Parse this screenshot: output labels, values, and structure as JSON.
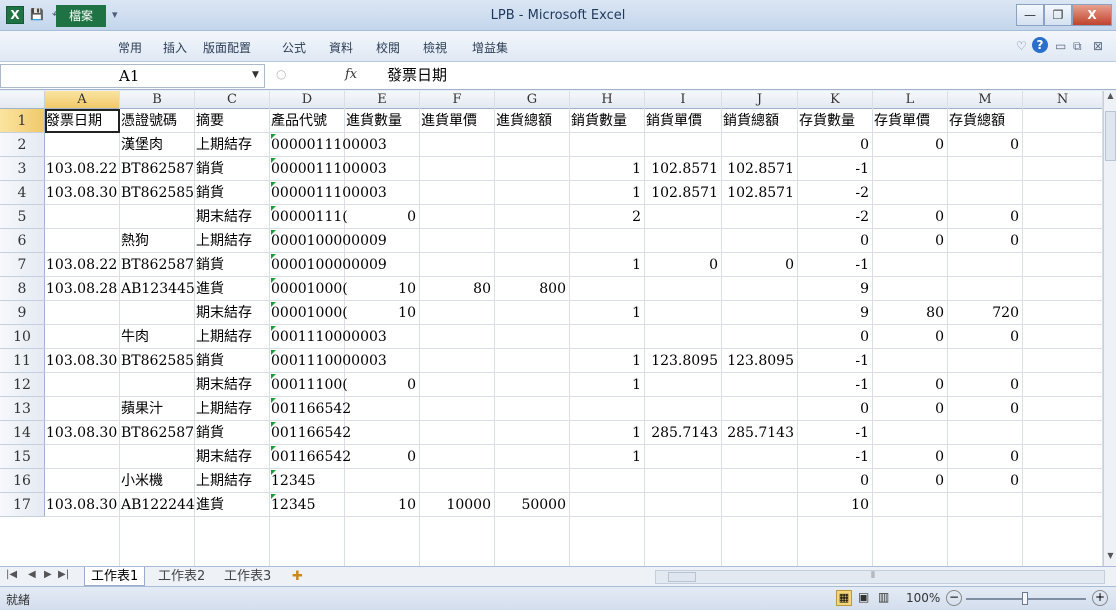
{
  "window": {
    "title": "LPB - Microsoft Excel",
    "app_icon": "X"
  },
  "quick_access": {
    "save": "💾",
    "undo": "↶ ▾",
    "redo": "↷ ▾",
    "customize": "▾"
  },
  "window_controls": {
    "minimize": "—",
    "restore": "❐",
    "close": "X"
  },
  "ribbon": {
    "tabs": [
      "檔案",
      "常用",
      "插入",
      "版面配置",
      "公式",
      "資料",
      "校閱",
      "檢視",
      "增益集"
    ],
    "right_icons": [
      "♡",
      "?",
      "▭",
      "⧉",
      "⊠"
    ],
    "help_color": "#2a6fc9"
  },
  "formula_bar": {
    "name_box": "A1",
    "fx_label": "fx",
    "cancel": "○",
    "value": "發票日期"
  },
  "columns": [
    "A",
    "B",
    "C",
    "D",
    "E",
    "F",
    "G",
    "H",
    "I",
    "J",
    "K",
    "L",
    "M",
    "N"
  ],
  "rows": [
    {
      "n": "1",
      "cells": {
        "A": "發票日期",
        "B": "憑證號碼",
        "C": "摘要",
        "D": "產品代號",
        "E": "進貨數量",
        "F": "進貨單價",
        "G": "進貨總額",
        "H": "銷貨數量",
        "I": "銷貨單價",
        "J": "銷貨總額",
        "K": "存貨數量",
        "L": "存貨單價",
        "M": "存貨總額"
      }
    },
    {
      "n": "2",
      "cells": {
        "B": "漢堡肉",
        "C": "上期結存",
        "D": "0000011100003",
        "K": "0",
        "L": "0",
        "M": "0"
      }
    },
    {
      "n": "3",
      "cells": {
        "A": "103.08.22",
        "B": "BT862587",
        "C": "銷貨",
        "D": "0000011100003",
        "H": "1",
        "I": "102.8571",
        "J": "102.8571",
        "K": "-1"
      }
    },
    {
      "n": "4",
      "cells": {
        "A": "103.08.30",
        "B": "BT862585",
        "C": "銷貨",
        "D": "0000011100003",
        "H": "1",
        "I": "102.8571",
        "J": "102.8571",
        "K": "-2"
      }
    },
    {
      "n": "5",
      "cells": {
        "C": "期末結存",
        "D": "00000111(",
        "E": "0",
        "H": "2",
        "K": "-2",
        "L": "0",
        "M": "0"
      }
    },
    {
      "n": "6",
      "cells": {
        "B": "熱狗",
        "C": "上期結存",
        "D": "0000100000009",
        "K": "0",
        "L": "0",
        "M": "0"
      }
    },
    {
      "n": "7",
      "cells": {
        "A": "103.08.22",
        "B": "BT862587",
        "C": "銷貨",
        "D": "0000100000009",
        "H": "1",
        "I": "0",
        "J": "0",
        "K": "-1"
      }
    },
    {
      "n": "8",
      "cells": {
        "A": "103.08.28",
        "B": "AB123445",
        "C": "進貨",
        "D": "00001000(",
        "E": "10",
        "F": "80",
        "G": "800",
        "K": "9"
      }
    },
    {
      "n": "9",
      "cells": {
        "C": "期末結存",
        "D": "00001000(",
        "E": "10",
        "H": "1",
        "K": "9",
        "L": "80",
        "M": "720"
      }
    },
    {
      "n": "10",
      "cells": {
        "B": "牛肉",
        "C": "上期結存",
        "D": "0001110000003",
        "K": "0",
        "L": "0",
        "M": "0"
      }
    },
    {
      "n": "11",
      "cells": {
        "A": "103.08.30",
        "B": "BT862585",
        "C": "銷貨",
        "D": "0001110000003",
        "H": "1",
        "I": "123.8095",
        "J": "123.8095",
        "K": "-1"
      }
    },
    {
      "n": "12",
      "cells": {
        "C": "期末結存",
        "D": "00011100(",
        "E": "0",
        "H": "1",
        "K": "-1",
        "L": "0",
        "M": "0"
      }
    },
    {
      "n": "13",
      "cells": {
        "B": "蘋果汁",
        "C": "上期結存",
        "D": "001166542",
        "K": "0",
        "L": "0",
        "M": "0"
      }
    },
    {
      "n": "14",
      "cells": {
        "A": "103.08.30",
        "B": "BT862587",
        "C": "銷貨",
        "D": "001166542",
        "H": "1",
        "I": "285.7143",
        "J": "285.7143",
        "K": "-1"
      }
    },
    {
      "n": "15",
      "cells": {
        "C": "期末結存",
        "D": "001166542",
        "E": "0",
        "H": "1",
        "K": "-1",
        "L": "0",
        "M": "0"
      }
    },
    {
      "n": "16",
      "cells": {
        "B": "小米機",
        "C": "上期結存",
        "D": "12345",
        "K": "0",
        "L": "0",
        "M": "0"
      }
    },
    {
      "n": "17",
      "cells": {
        "A": "103.08.30",
        "B": "AB122244",
        "C": "進貨",
        "D": "12345",
        "E": "10",
        "F": "10000",
        "G": "50000",
        "K": "10"
      }
    }
  ],
  "sheet_tabs": [
    "工作表1",
    "工作表2",
    "工作表3"
  ],
  "sheet_nav": [
    "|◀",
    "◀",
    "▶",
    "▶|"
  ],
  "new_sheet_icon": "✚",
  "hscroll_thumb": "⦀",
  "status": {
    "ready": "就緒",
    "zoom": "100%",
    "zoom_minus": "−",
    "zoom_plus": "+",
    "view_icons": [
      "▦",
      "▣",
      "▥"
    ]
  },
  "colors": {
    "selection_header": "#f0c96a",
    "file_tab": "#1f7244",
    "close_button": "#c0432b",
    "text_marker": "#1d9e3a"
  }
}
